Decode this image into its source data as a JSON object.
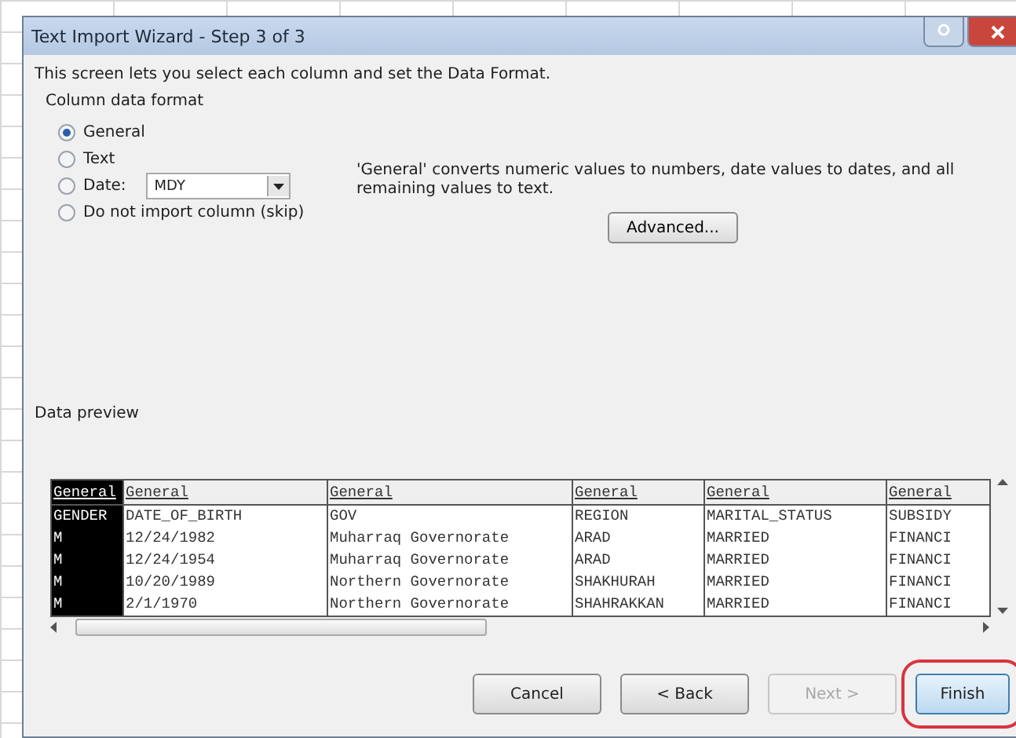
{
  "window": {
    "title": "Text Import Wizard - Step 3 of 3"
  },
  "intro": "This screen lets you select each column and set the Data Format.",
  "column_data_format": {
    "label": "Column data format",
    "options": [
      {
        "label": "General",
        "selected": true
      },
      {
        "label": "Text",
        "selected": false
      },
      {
        "label": "Date:",
        "selected": false,
        "kind": "date",
        "dropdown_value": "MDY"
      },
      {
        "label": "Do not import column (skip)",
        "selected": false
      }
    ]
  },
  "description": "'General' converts numeric values to numbers, date values to dates, and all remaining values to text.",
  "advanced_button": "Advanced...",
  "data_preview": {
    "label": "Data preview",
    "columns": [
      {
        "header": "General",
        "selected": true
      },
      {
        "header": "General",
        "selected": false
      },
      {
        "header": "General",
        "selected": false
      },
      {
        "header": "General",
        "selected": false
      },
      {
        "header": "General",
        "selected": false
      },
      {
        "header": "General",
        "selected": false
      }
    ],
    "rows": [
      [
        "GENDER",
        "DATE_OF_BIRTH",
        "GOV",
        "REGION",
        "MARITAL_STATUS",
        "SUBSIDY"
      ],
      [
        "M",
        "12/24/1982",
        "Muharraq Governorate",
        "ARAD",
        "MARRIED",
        "FINANCI"
      ],
      [
        "M",
        "12/24/1954",
        "Muharraq Governorate",
        "ARAD",
        "MARRIED",
        "FINANCI"
      ],
      [
        "M",
        "10/20/1989",
        "Northern Governorate",
        "SHAKHURAH",
        "MARRIED",
        "FINANCI"
      ],
      [
        "M",
        "2/1/1970",
        "Northern Governorate",
        "SHAHRAKKAN",
        "MARRIED",
        "FINANCI"
      ]
    ]
  },
  "buttons": [
    {
      "label": "Cancel",
      "disabled": false,
      "highlighted": false
    },
    {
      "label": "< Back",
      "disabled": false,
      "highlighted": false
    },
    {
      "label": "Next >",
      "disabled": true,
      "highlighted": false
    },
    {
      "label": "Finish",
      "disabled": false,
      "highlighted": true
    }
  ]
}
